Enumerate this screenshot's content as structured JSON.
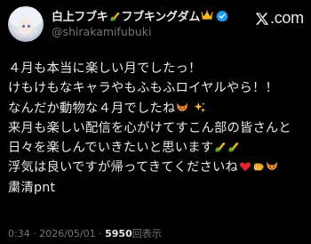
{
  "header": {
    "display_name": "白上フブキ",
    "display_name_suffix": "フブキングダム",
    "handle": "@shirakamifubuki",
    "site_label": "com",
    "icons": {
      "avatar": "avatar-image",
      "corn": "corn-emoji",
      "crown": "crown-emoji",
      "verified": "verified-badge-icon",
      "x": "x-logo-icon"
    }
  },
  "tweet": {
    "lines": [
      "４月も本当に楽しい月でしたっ！",
      "けもけもなキャラやもふもふロイヤルやら！！",
      "なんだか動物な４月でしたね",
      "来月も楽しい配信を心がけてすこん部の皆さんと",
      "日々を楽しんでいきたいと思います",
      "浮気は良いですが帰ってきてくださいね",
      "粛清pnt"
    ],
    "emoji": {
      "line3": [
        "fox-emoji",
        "sparkles-emoji"
      ],
      "line5": [
        "corn-emoji",
        "corn-emoji"
      ],
      "line6": [
        "red-heart-emoji",
        "fist-emoji",
        "fox-emoji"
      ]
    }
  },
  "footer": {
    "time": "0:34",
    "date": "2026/05/01",
    "views_count": "5950",
    "views_label": "回表示",
    "separator": "·"
  },
  "colors": {
    "background": "#000000",
    "text": "#e7e9ea",
    "muted": "#71767b",
    "verified": "#1d9bf0"
  }
}
